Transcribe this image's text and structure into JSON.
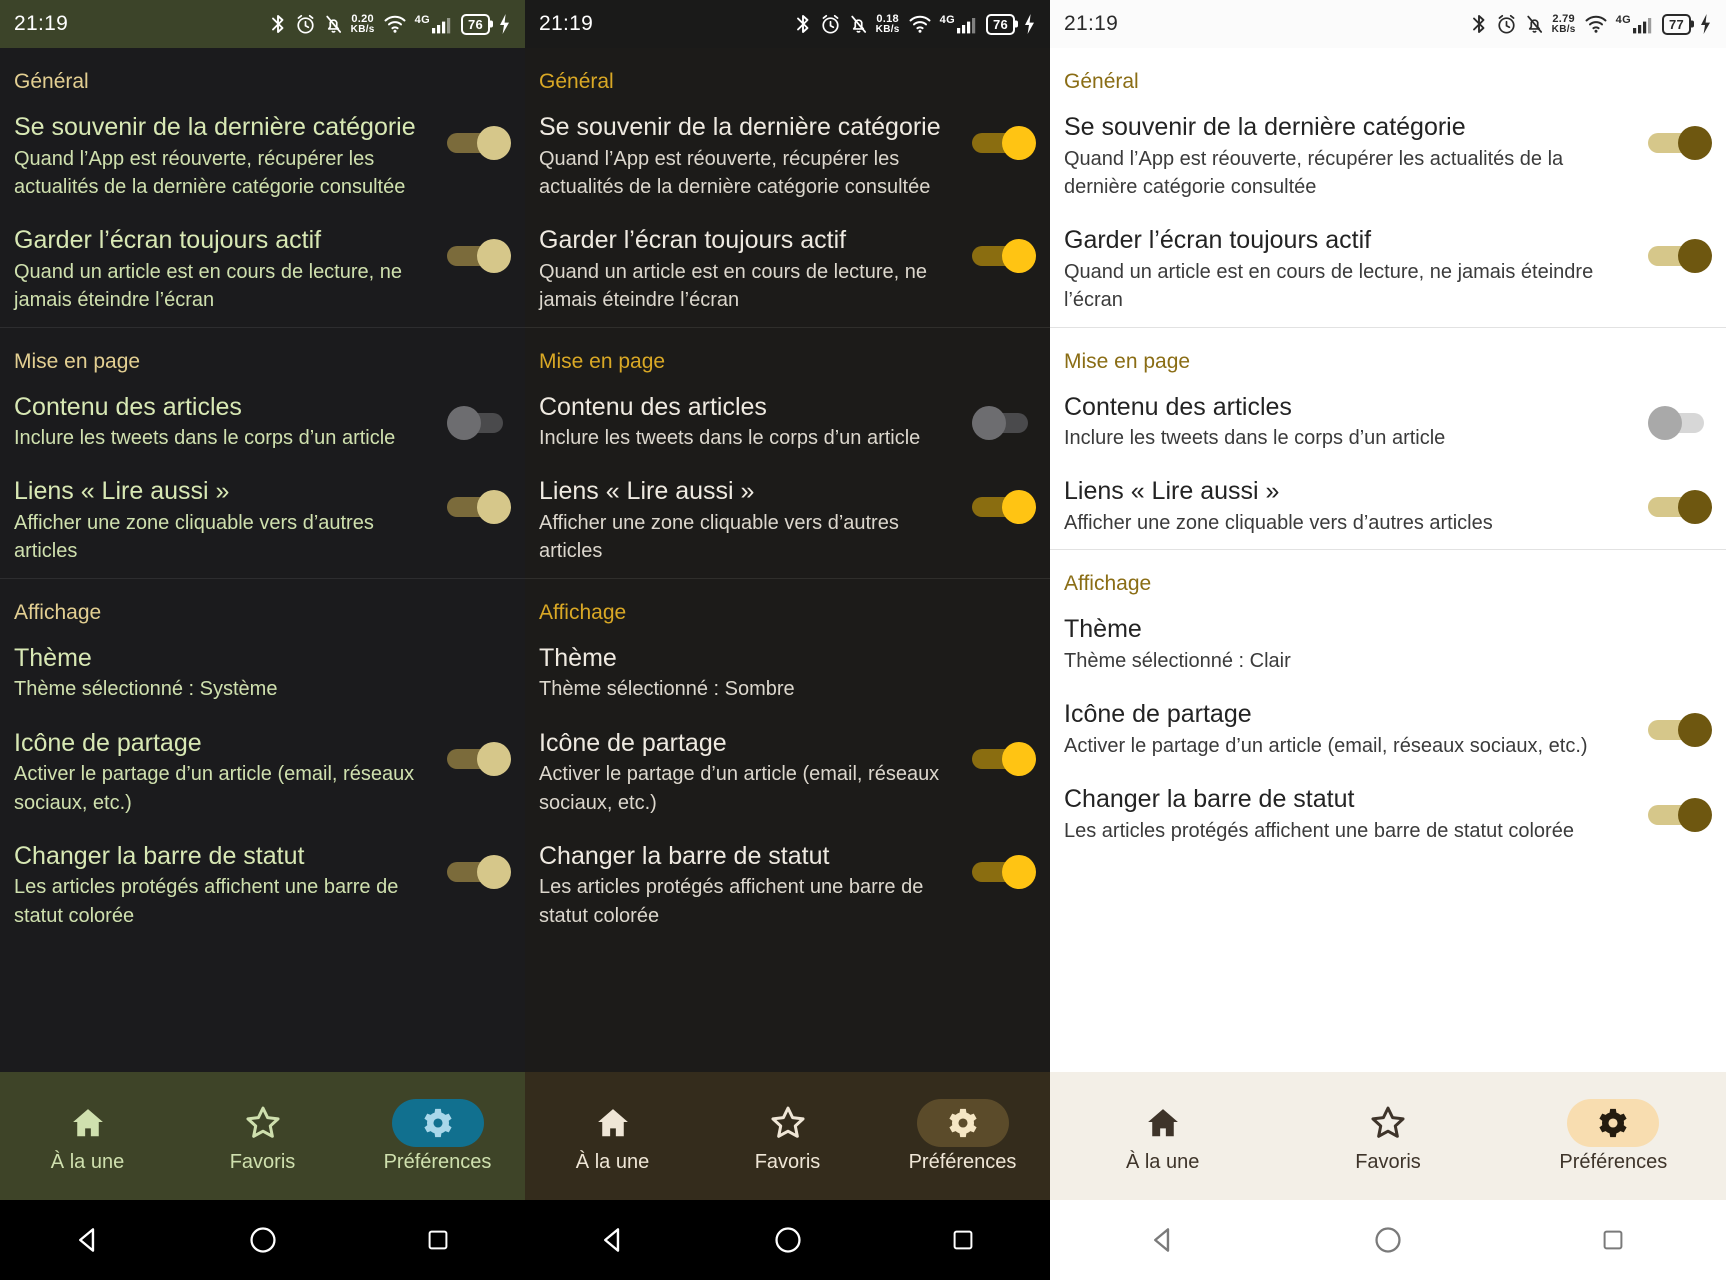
{
  "panels": [
    {
      "id": "system-theme-panel",
      "status": {
        "time": "21:19",
        "net_speed": "0.20",
        "net_unit": "KB/s",
        "network": "4G",
        "battery": "76"
      },
      "sections": [
        {
          "title": "Général",
          "rows": [
            {
              "title": "Se souvenir de la dernière catégorie",
              "sub": "Quand l’App est réouverte, récupérer les actualités de la dernière catégorie consultée",
              "toggle": "on"
            },
            {
              "title": "Garder l’écran toujours actif",
              "sub": "Quand un article est en cours de lecture, ne jamais éteindre l’écran",
              "toggle": "on"
            }
          ]
        },
        {
          "title": "Mise en page",
          "rows": [
            {
              "title": "Contenu des articles",
              "sub": "Inclure les tweets dans le corps d’un article",
              "toggle": "off"
            },
            {
              "title": "Liens « Lire aussi »",
              "sub": "Afficher une zone cliquable vers d’autres articles",
              "toggle": "on"
            }
          ]
        },
        {
          "title": "Affichage",
          "rows": [
            {
              "title": "Thème",
              "sub": "Thème sélectionné : Système",
              "toggle": "none"
            },
            {
              "title": "Icône de partage",
              "sub": "Activer le partage d’un article (email, réseaux sociaux, etc.)",
              "toggle": "on"
            },
            {
              "title": "Changer la barre de statut",
              "sub": "Les articles protégés affichent une barre de statut colorée",
              "toggle": "on"
            }
          ]
        }
      ],
      "nav": [
        {
          "label": "À la une",
          "icon": "home-icon",
          "active": false
        },
        {
          "label": "Favoris",
          "icon": "star-icon",
          "active": false
        },
        {
          "label": "Préférences",
          "icon": "gear-icon",
          "active": true
        }
      ],
      "colors": {
        "accent": "#11708f",
        "section_header": "#e3cf92",
        "toggle_on": "#d6c78a",
        "navbar": "#3e4428"
      }
    },
    {
      "id": "dark-theme-panel",
      "status": {
        "time": "21:19",
        "net_speed": "0.18",
        "net_unit": "KB/s",
        "network": "4G",
        "battery": "76"
      },
      "sections": [
        {
          "title": "Général",
          "rows": [
            {
              "title": "Se souvenir de la dernière catégorie",
              "sub": "Quand l’App est réouverte, récupérer les actualités de la dernière catégorie consultée",
              "toggle": "on"
            },
            {
              "title": "Garder l’écran toujours actif",
              "sub": "Quand un article est en cours de lecture, ne jamais éteindre l’écran",
              "toggle": "on"
            }
          ]
        },
        {
          "title": "Mise en page",
          "rows": [
            {
              "title": "Contenu des articles",
              "sub": "Inclure les tweets dans le corps d’un article",
              "toggle": "off"
            },
            {
              "title": "Liens « Lire aussi »",
              "sub": "Afficher une zone cliquable vers d’autres articles",
              "toggle": "on"
            }
          ]
        },
        {
          "title": "Affichage",
          "rows": [
            {
              "title": "Thème",
              "sub": "Thème sélectionné : Sombre",
              "toggle": "none"
            },
            {
              "title": "Icône de partage",
              "sub": "Activer le partage d’un article (email, réseaux sociaux, etc.)",
              "toggle": "on"
            },
            {
              "title": "Changer la barre de statut",
              "sub": "Les articles protégés affichent une barre de statut colorée",
              "toggle": "on"
            }
          ]
        }
      ],
      "nav": [
        {
          "label": "À la une",
          "icon": "home-icon",
          "active": false
        },
        {
          "label": "Favoris",
          "icon": "star-icon",
          "active": false
        },
        {
          "label": "Préférences",
          "icon": "gear-icon",
          "active": true
        }
      ],
      "colors": {
        "accent": "#5b4b2a",
        "section_header": "#d9a825",
        "toggle_on": "#ffc413",
        "navbar": "#342c1c"
      }
    },
    {
      "id": "light-theme-panel",
      "status": {
        "time": "21:19",
        "net_speed": "2.79",
        "net_unit": "KB/s",
        "network": "4G",
        "battery": "77"
      },
      "sections": [
        {
          "title": "Général",
          "rows": [
            {
              "title": "Se souvenir de la dernière catégorie",
              "sub": "Quand l’App est réouverte, récupérer les actualités de la dernière catégorie consultée",
              "toggle": "on"
            },
            {
              "title": "Garder l’écran toujours actif",
              "sub": "Quand un article est en cours de lecture, ne jamais éteindre l’écran",
              "toggle": "on"
            }
          ]
        },
        {
          "title": "Mise en page",
          "rows": [
            {
              "title": "Contenu des articles",
              "sub": "Inclure les tweets dans le corps d’un article",
              "toggle": "off"
            },
            {
              "title": "Liens « Lire aussi »",
              "sub": "Afficher une zone cliquable vers d’autres articles",
              "toggle": "on"
            }
          ]
        },
        {
          "title": "Affichage",
          "rows": [
            {
              "title": "Thème",
              "sub": "Thème sélectionné : Clair",
              "toggle": "none"
            },
            {
              "title": "Icône de partage",
              "sub": "Activer le partage d’un article (email, réseaux sociaux, etc.)",
              "toggle": "on"
            },
            {
              "title": "Changer la barre de statut",
              "sub": "Les articles protégés affichent une barre de statut colorée",
              "toggle": "on"
            }
          ]
        }
      ],
      "nav": [
        {
          "label": "À la une",
          "icon": "home-icon",
          "active": false
        },
        {
          "label": "Favoris",
          "icon": "star-icon",
          "active": false
        },
        {
          "label": "Préférences",
          "icon": "gear-icon",
          "active": true
        }
      ],
      "colors": {
        "accent": "#f8ddb0",
        "section_header": "#8a6d15",
        "toggle_on": "#6e5710",
        "navbar": "#f3efe7"
      }
    }
  ],
  "status_icon_names": [
    "bluetooth-icon",
    "alarm-icon",
    "notifications-off-icon",
    "network-speed-label",
    "wifi-icon",
    "cellular-signal-icon",
    "battery-icon",
    "charging-bolt-icon"
  ],
  "sysnav_icons": [
    "back-triangle-icon",
    "home-circle-icon",
    "recents-square-icon"
  ]
}
